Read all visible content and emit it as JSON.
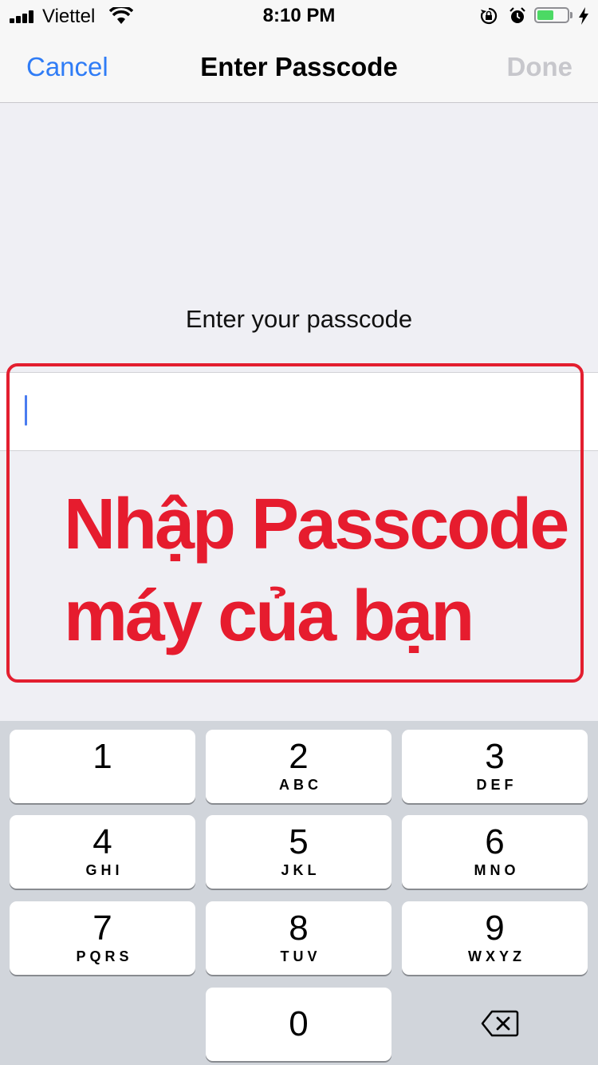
{
  "status_bar": {
    "carrier": "Viettel",
    "time": "8:10 PM",
    "battery_level": 0.55,
    "icons": [
      "signal-icon",
      "wifi-icon",
      "rotation-lock-icon",
      "alarm-icon",
      "battery-icon",
      "charging-bolt-icon"
    ]
  },
  "nav": {
    "cancel_label": "Cancel",
    "title": "Enter Passcode",
    "done_label": "Done"
  },
  "prompt": "Enter your passcode",
  "passcode_field": {
    "value": ""
  },
  "annotation": {
    "line1": "Nhập Passcode",
    "line2": "máy của bạn",
    "color": "#e61c2e"
  },
  "keypad": {
    "keys": [
      {
        "digit": "1",
        "letters": ""
      },
      {
        "digit": "2",
        "letters": "ABC"
      },
      {
        "digit": "3",
        "letters": "DEF"
      },
      {
        "digit": "4",
        "letters": "GHI"
      },
      {
        "digit": "5",
        "letters": "JKL"
      },
      {
        "digit": "6",
        "letters": "MNO"
      },
      {
        "digit": "7",
        "letters": "PQRS"
      },
      {
        "digit": "8",
        "letters": "TUV"
      },
      {
        "digit": "9",
        "letters": "WXYZ"
      },
      {
        "digit": "0",
        "letters": ""
      }
    ],
    "delete_icon": "backspace-icon"
  },
  "colors": {
    "accent": "#2f7cf6",
    "disabled": "#c7c7cc",
    "battery": "#4cd964",
    "annotation_border": "#e31e2f"
  }
}
